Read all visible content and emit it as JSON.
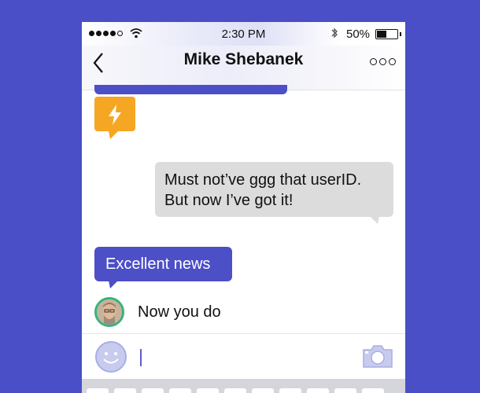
{
  "status_bar": {
    "time": "2:30 PM",
    "battery_percent": "50%",
    "battery_level": 0.5,
    "signal_bars_filled": 4,
    "signal_bars_total": 5
  },
  "nav": {
    "title": "Mike Shebanek",
    "back_icon": "chevron-left-icon",
    "more_icon": "more-dots-icon"
  },
  "messages": {
    "bolt_icon": "lightning-bolt-icon",
    "incoming_lines": [
      "Must not’ve ggg that userID.",
      "But now I’ve got it!"
    ],
    "outgoing_text": "Excellent news",
    "typing_text": "Now you do"
  },
  "composer": {
    "emoji_icon": "smiley-icon",
    "camera_icon": "camera-icon",
    "input_value": ""
  },
  "colors": {
    "background": "#4a4fc7",
    "accent_bubble": "#4c4fc6",
    "bolt_bubble": "#f5a623",
    "incoming_bubble": "#dcdcdc",
    "avatar_ring": "#36b37e",
    "icon_tint": "#a9aee6"
  }
}
